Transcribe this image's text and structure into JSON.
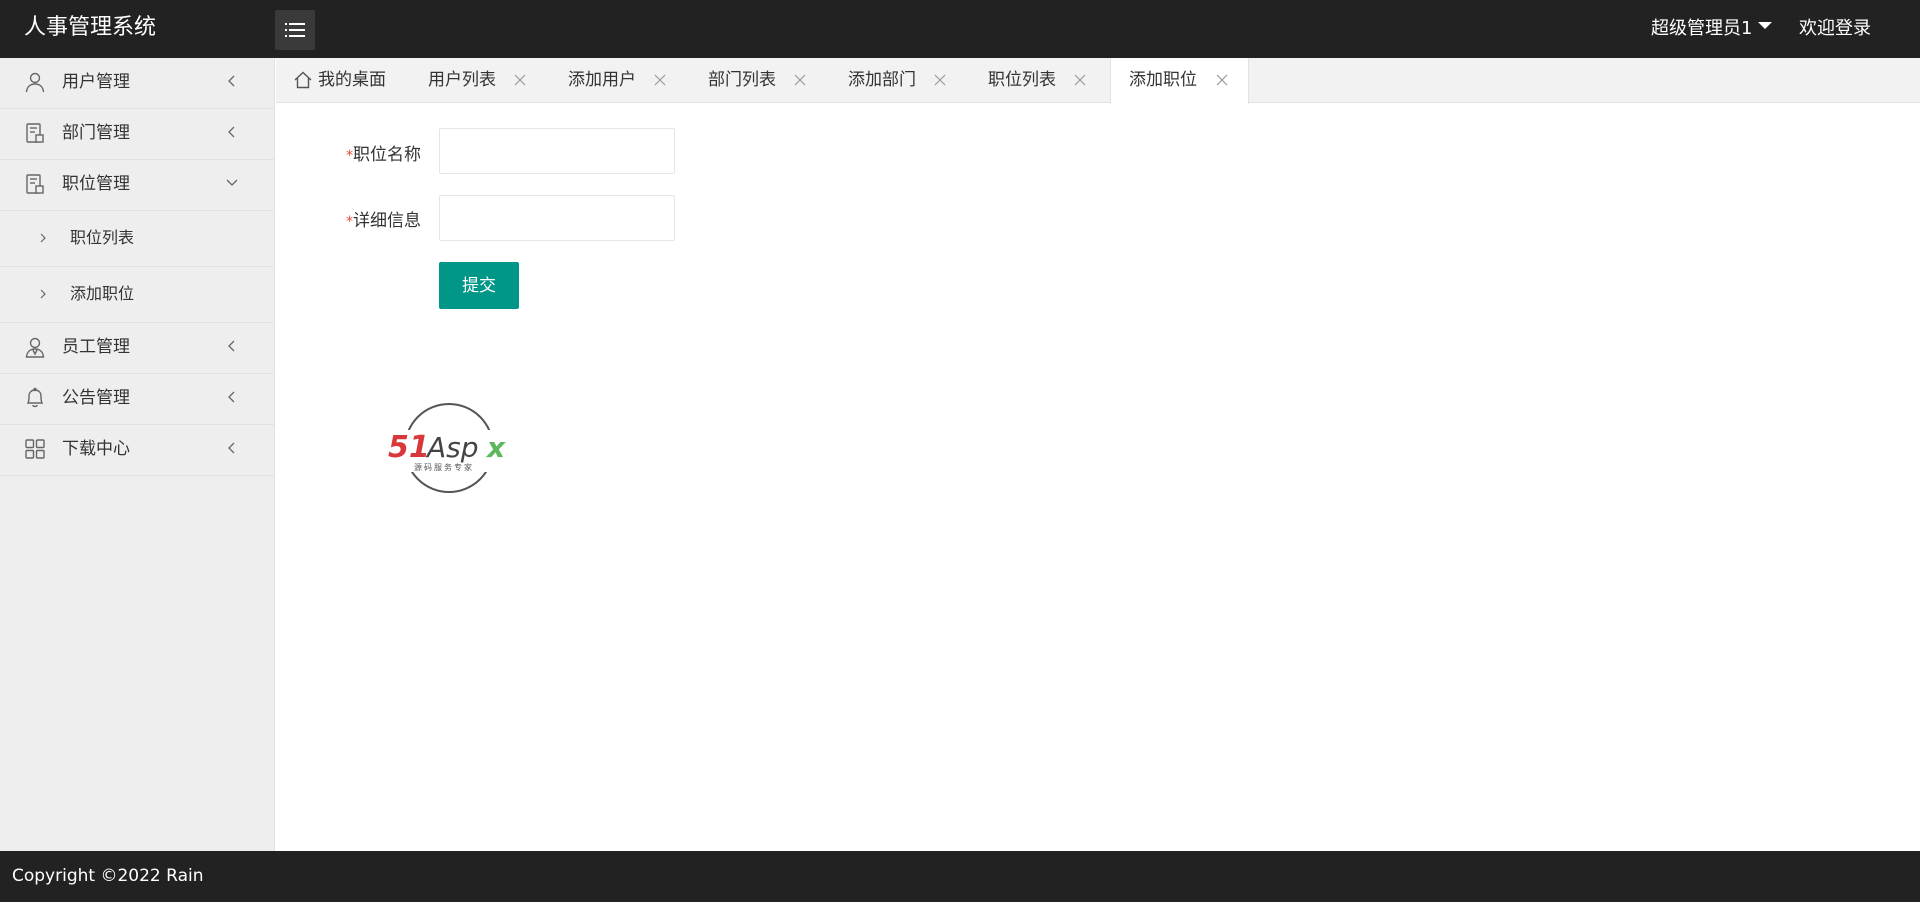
{
  "header": {
    "app_title": "人事管理系统",
    "user_menu_label": "超级管理员1",
    "welcome_label": "欢迎登录"
  },
  "sidebar": {
    "items": [
      {
        "label": "用户管理",
        "icon": "user-icon"
      },
      {
        "label": "部门管理",
        "icon": "building-icon"
      },
      {
        "label": "职位管理",
        "icon": "building-icon",
        "expanded": true,
        "children": [
          {
            "label": "职位列表"
          },
          {
            "label": "添加职位"
          }
        ]
      },
      {
        "label": "员工管理",
        "icon": "staff-icon"
      },
      {
        "label": "公告管理",
        "icon": "bell-icon"
      },
      {
        "label": "下载中心",
        "icon": "grid-icon"
      }
    ]
  },
  "tabs": [
    {
      "label": "我的桌面",
      "closable": false
    },
    {
      "label": "用户列表",
      "closable": true
    },
    {
      "label": "添加用户",
      "closable": true
    },
    {
      "label": "部门列表",
      "closable": true
    },
    {
      "label": "添加部门",
      "closable": true
    },
    {
      "label": "职位列表",
      "closable": true
    },
    {
      "label": "添加职位",
      "closable": true,
      "active": true
    }
  ],
  "form": {
    "required_mark": "*",
    "position_name_label": "职位名称",
    "position_name_value": "",
    "detail_label": "详细信息",
    "detail_value": "",
    "submit_label": "提交"
  },
  "watermark": {
    "brand_text": "51Aspx",
    "sub_text": "源码服务专家"
  },
  "footer": {
    "copyright": "Copyright ©2022 Rain"
  },
  "colors": {
    "header_bg": "#222222",
    "sidebar_bg": "#eeeeee",
    "accent": "#009688",
    "required": "#e74c3c"
  }
}
